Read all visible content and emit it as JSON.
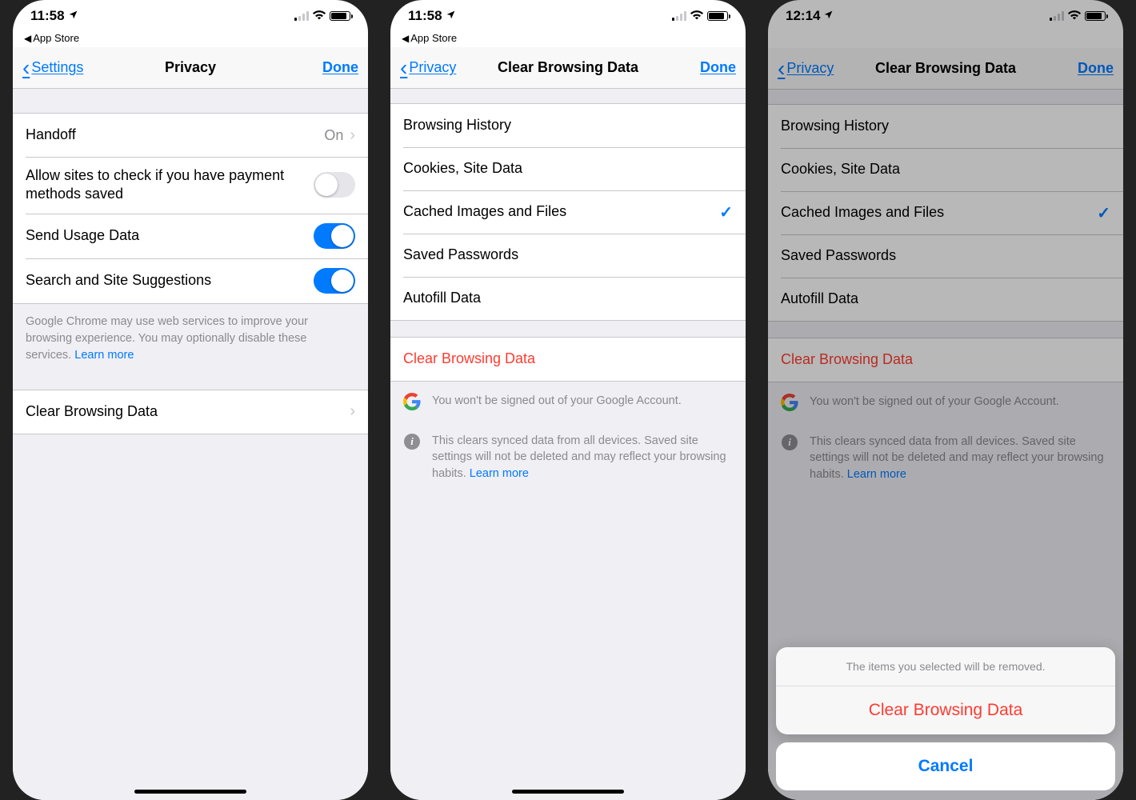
{
  "panel1": {
    "status_time": "11:58",
    "breadcrumb": "App Store",
    "back_label": "Settings",
    "title": "Privacy",
    "done": "Done",
    "rows": {
      "handoff": {
        "label": "Handoff",
        "value": "On"
      },
      "payment": {
        "label": "Allow sites to check if you have payment methods saved",
        "on": false
      },
      "usage": {
        "label": "Send Usage Data",
        "on": true
      },
      "suggest": {
        "label": "Search and Site Suggestions",
        "on": true
      }
    },
    "footer_text": "Google Chrome may use web services to improve your browsing experience. You may optionally disable these services. ",
    "footer_link": "Learn more",
    "clear_row": "Clear Browsing Data"
  },
  "panel2": {
    "status_time": "11:58",
    "breadcrumb": "App Store",
    "back_label": "Privacy",
    "title": "Clear Browsing Data",
    "done": "Done",
    "items": [
      {
        "label": "Browsing History",
        "checked": false
      },
      {
        "label": "Cookies, Site Data",
        "checked": false
      },
      {
        "label": "Cached Images and Files",
        "checked": true
      },
      {
        "label": "Saved Passwords",
        "checked": false
      },
      {
        "label": "Autofill Data",
        "checked": false
      }
    ],
    "action_label": "Clear Browsing Data",
    "google_note": "You won't be signed out of your Google Account.",
    "info_note_1": "This clears synced data from all devices. Saved site settings will not be deleted and may reflect your browsing habits. ",
    "info_link": "Learn more"
  },
  "panel3": {
    "status_time": "12:14",
    "back_label": "Privacy",
    "title": "Clear Browsing Data",
    "done": "Done",
    "items": [
      {
        "label": "Browsing History",
        "checked": false
      },
      {
        "label": "Cookies, Site Data",
        "checked": false
      },
      {
        "label": "Cached Images and Files",
        "checked": true
      },
      {
        "label": "Saved Passwords",
        "checked": false
      },
      {
        "label": "Autofill Data",
        "checked": false
      }
    ],
    "action_label": "Clear Browsing Data",
    "google_note": "You won't be signed out of your Google Account.",
    "info_note_1": "This clears synced data from all devices. Saved site settings will not be deleted and may reflect your browsing habits. ",
    "info_link": "Learn more",
    "sheet": {
      "message": "The items you selected will be removed.",
      "confirm": "Clear Browsing Data",
      "cancel": "Cancel"
    }
  },
  "battery_pct": 78
}
